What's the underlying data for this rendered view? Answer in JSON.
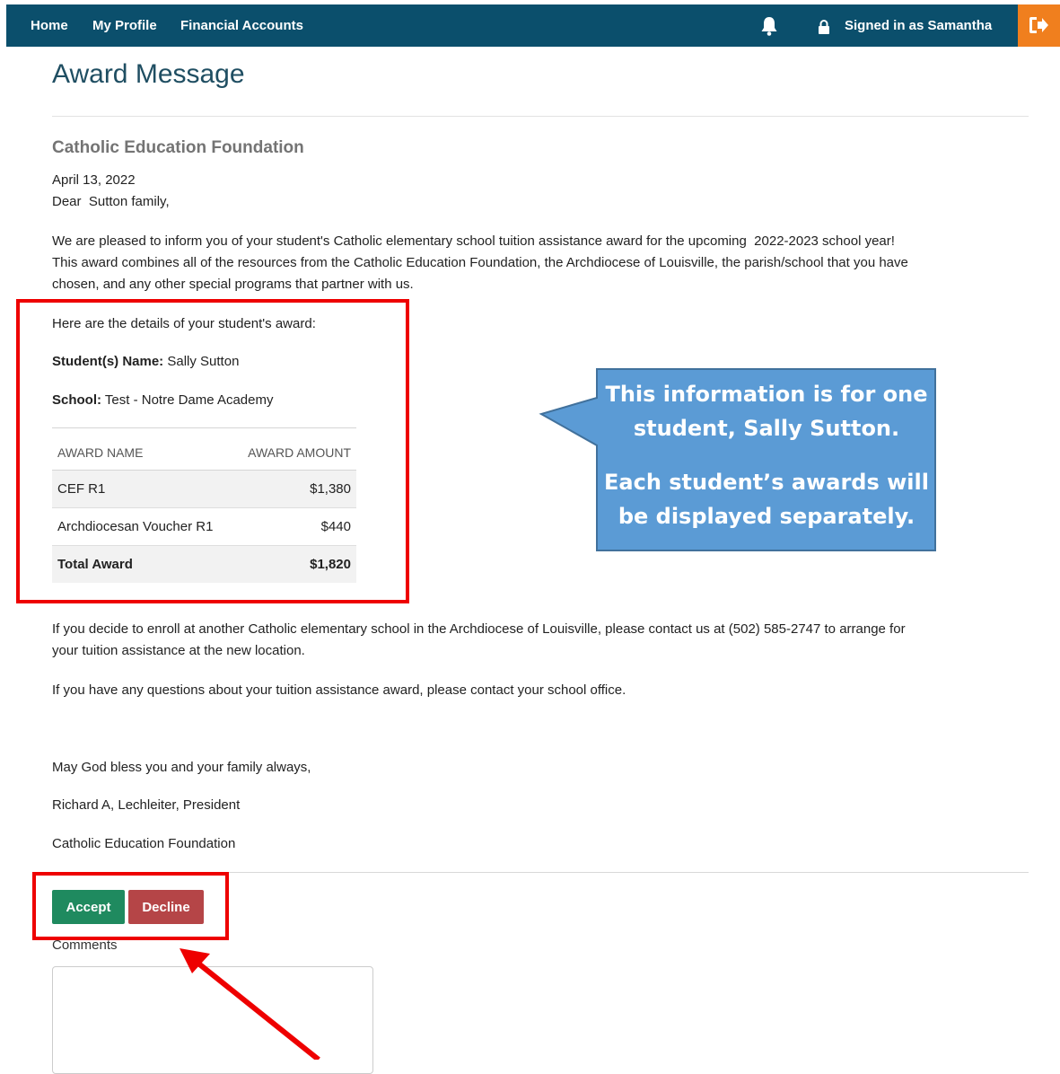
{
  "nav": {
    "home": "Home",
    "profile": "My Profile",
    "financial": "Financial Accounts",
    "signed_in": "Signed in as Samantha",
    "icons": [
      "bell-icon",
      "lock-icon",
      "logout-icon"
    ]
  },
  "page": {
    "title": "Award Message",
    "org": "Catholic Education Foundation",
    "date": "April 13, 2022",
    "salutation": "Dear  Sutton family,",
    "intro_line1": "We are pleased to inform you of your student's Catholic elementary school tuition assistance award for the upcoming  2022-2023 school year!",
    "intro_line2": "This award combines all of the resources from the Catholic Education Foundation, the Archdiocese of Louisville, the parish/school that you have",
    "intro_line3": "chosen, and any other special programs that partner with us."
  },
  "details": {
    "intro": "Here are the details of your student's award:",
    "student_label": "Student(s) Name:",
    "student_value": "Sally Sutton",
    "school_label": "School:",
    "school_value": "Test - Notre Dame Academy"
  },
  "table": {
    "headers": [
      "AWARD NAME",
      "AWARD AMOUNT"
    ],
    "rows": [
      {
        "name": "CEF R1",
        "amount": "$1,380"
      },
      {
        "name": "Archdiocesan Voucher R1",
        "amount": "$440"
      }
    ],
    "total_label": "Total Award",
    "total_amount": "$1,820"
  },
  "callout": {
    "line1": "This information is for one student, Sally Sutton.",
    "line2": "Each student’s awards will be displayed separately."
  },
  "body": {
    "enroll_line1": "If you decide to enroll at another Catholic elementary school in the Archdiocese of Louisville, please contact us at (502) 585-2747 to arrange for",
    "enroll_line2": "your tuition assistance at the new location.",
    "questions": "If you have any questions about your tuition assistance award, please contact your school office.",
    "blessing": "May God bless you and your family always,",
    "signer": "Richard A, Lechleiter, President",
    "signer_org": "Catholic Education Foundation"
  },
  "actions": {
    "accept": "Accept",
    "decline": "Decline",
    "comments_label": "Comments",
    "comments_value": ""
  },
  "colors": {
    "navbar": "#0b4f6c",
    "logout": "#f07f1e",
    "accept": "#1f8a5f",
    "decline": "#b54547",
    "callout": "#5b9bd5",
    "highlight": "#ee0000"
  }
}
